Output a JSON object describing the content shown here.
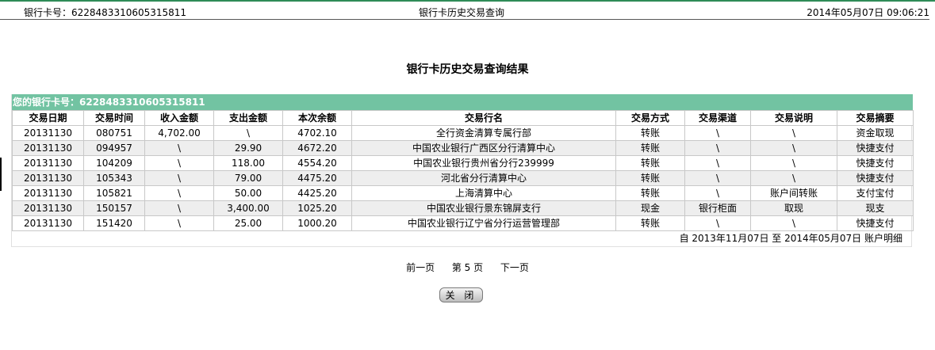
{
  "header": {
    "card_label": "银行卡号：6228483310605315811",
    "title": "银行卡历史交易查询",
    "datetime": "2014年05月07日 09:06:21"
  },
  "page_title": "银行卡历史交易查询结果",
  "result": {
    "card_bar": "您的银行卡号：6228483310605315811",
    "columns": [
      "交易日期",
      "交易时间",
      "收入金额",
      "支出金额",
      "本次余额",
      "交易行名",
      "交易方式",
      "交易渠道",
      "交易说明",
      "交易摘要"
    ],
    "rows": [
      [
        "20131130",
        "080751",
        "4,702.00",
        "\\",
        "4702.10",
        "全行资金清算专属行部",
        "转账",
        "\\",
        "\\",
        "资金取现"
      ],
      [
        "20131130",
        "094957",
        "\\",
        "29.90",
        "4672.20",
        "中国农业银行广西区分行清算中心",
        "转账",
        "\\",
        "\\",
        "快捷支付"
      ],
      [
        "20131130",
        "104209",
        "\\",
        "118.00",
        "4554.20",
        "中国农业银行贵州省分行239999",
        "转账",
        "\\",
        "\\",
        "快捷支付"
      ],
      [
        "20131130",
        "105343",
        "\\",
        "79.00",
        "4475.20",
        "河北省分行清算中心",
        "转账",
        "\\",
        "\\",
        "快捷支付"
      ],
      [
        "20131130",
        "105821",
        "\\",
        "50.00",
        "4425.20",
        "上海清算中心",
        "转账",
        "\\",
        "账户间转账",
        "支付宝付"
      ],
      [
        "20131130",
        "150157",
        "\\",
        "3,400.00",
        "1025.20",
        "中国农业银行景东锦屏支行",
        "现金",
        "银行柜面",
        "取现",
        "现支"
      ],
      [
        "20131130",
        "151420",
        "\\",
        "25.00",
        "1000.20",
        "中国农业银行辽宁省分行运营管理部",
        "转账",
        "\\",
        "\\",
        "快捷支付"
      ]
    ],
    "range_text": "自  2013年11月07日  至  2014年05月07日  账户明细"
  },
  "pager": {
    "prev": "前一页",
    "page_prefix": "第",
    "page_number": "5",
    "page_suffix": "页",
    "next": "下一页"
  },
  "close_button": "关 闭"
}
